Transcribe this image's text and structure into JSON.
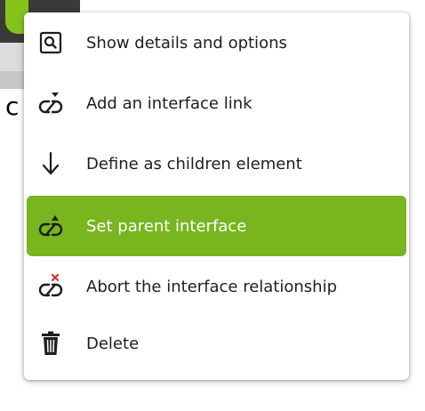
{
  "background": {
    "partial_text": "c"
  },
  "context_menu": {
    "items": [
      {
        "label": "Show details and options",
        "icon": "magnifier-icon"
      },
      {
        "label": "Add an interface link",
        "icon": "link-add-icon"
      },
      {
        "label": "Define as children element",
        "icon": "arrow-down-icon"
      },
      {
        "label": "Set parent interface",
        "icon": "link-parent-icon",
        "highlighted": true
      },
      {
        "label": "Abort the interface relationship",
        "icon": "link-remove-icon"
      },
      {
        "label": "Delete",
        "icon": "trash-icon"
      }
    ],
    "colors": {
      "highlight": "#78b51e",
      "text": "#1e1e1e",
      "highlight_text": "#ffffff",
      "remove_accent": "#e03030"
    }
  }
}
